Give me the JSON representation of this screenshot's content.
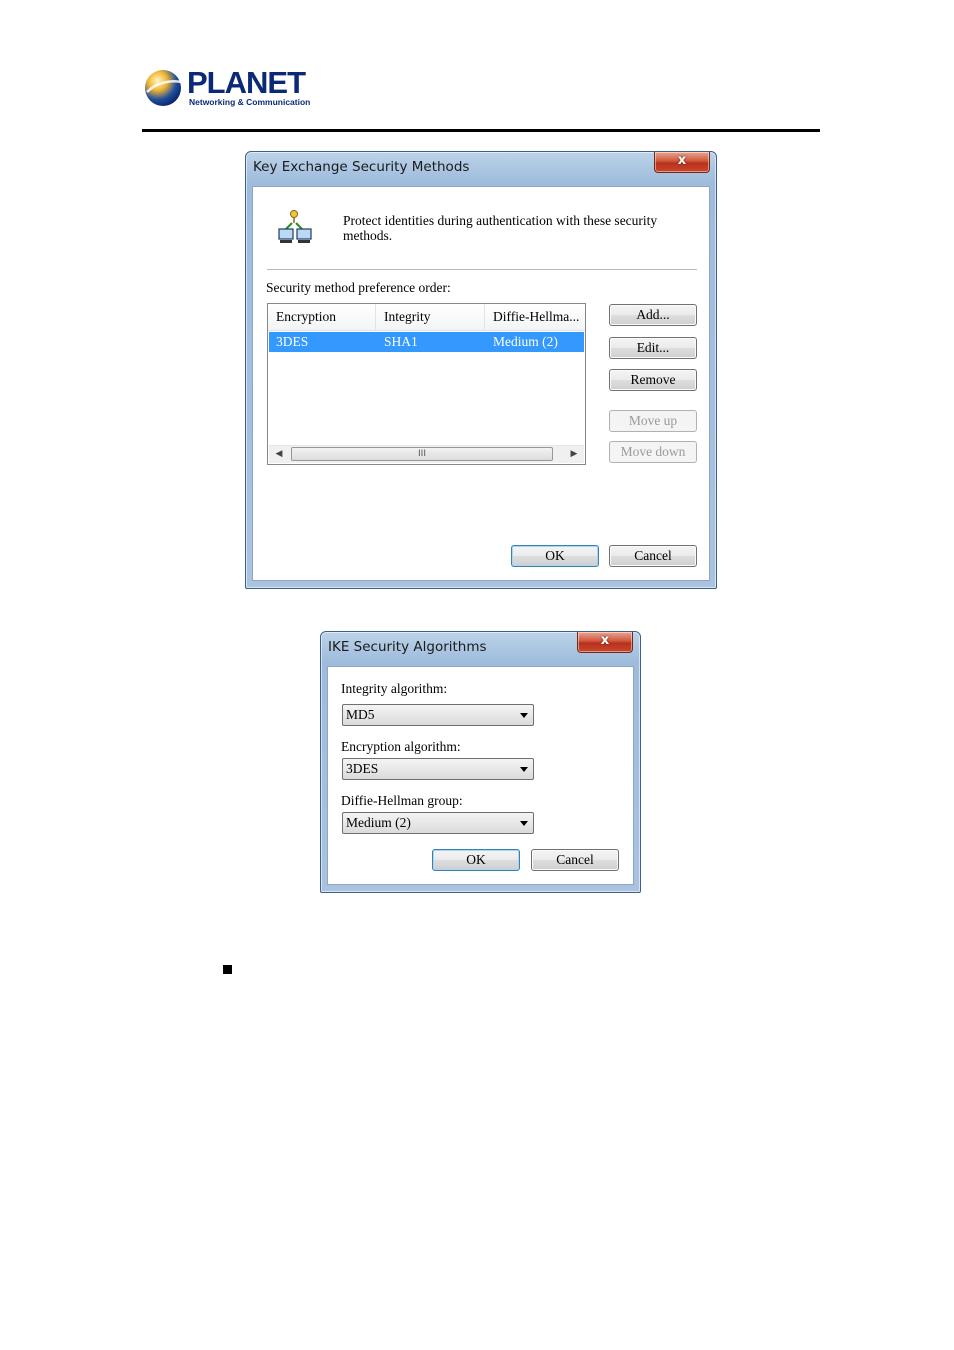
{
  "header": {
    "logo_text": "PLANET",
    "logo_subtitle": "Networking & Communication"
  },
  "key_exchange_dialog": {
    "title": "Key Exchange Security Methods",
    "close_label": "x",
    "description": "Protect identities during authentication with these security methods.",
    "list_label": "Security method preference order:",
    "columns": [
      "Encryption",
      "Integrity",
      "Diffie-Hellma..."
    ],
    "rows": [
      {
        "encryption": "3DES",
        "integrity": "SHA1",
        "dh": "Medium (2)",
        "selected": true
      }
    ],
    "scroll_grip": "III",
    "buttons": {
      "add": "Add...",
      "edit": "Edit...",
      "remove": "Remove",
      "move_up": "Move up",
      "move_down": "Move down",
      "ok": "OK",
      "cancel": "Cancel"
    }
  },
  "ike_dialog": {
    "title": "IKE Security Algorithms",
    "close_label": "x",
    "integrity_label": "Integrity algorithm:",
    "integrity_value": "MD5",
    "encryption_label": "Encryption algorithm:",
    "encryption_value": "3DES",
    "dh_label": "Diffie-Hellman group:",
    "dh_value": "Medium (2)",
    "buttons": {
      "ok": "OK",
      "cancel": "Cancel"
    }
  },
  "colors": {
    "brand": "#0a2a78",
    "selection": "#3399ff",
    "close_button": "#c9462c"
  }
}
